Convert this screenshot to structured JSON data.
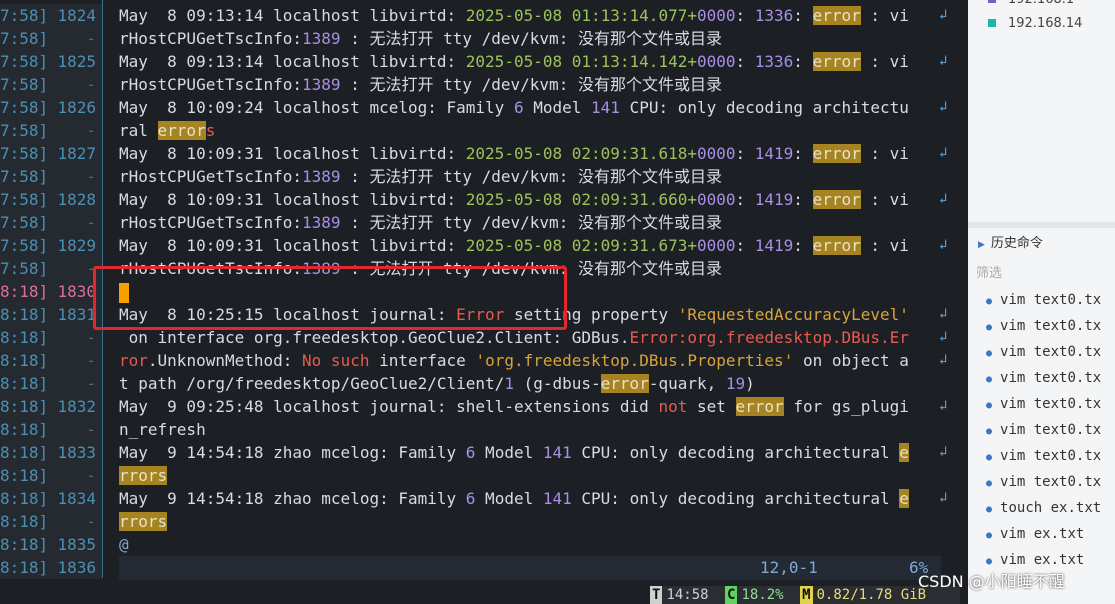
{
  "gutter": {
    "rows": [
      {
        "ts": "7:58]",
        "ln": "1824"
      },
      {
        "ts": "7:58]",
        "ln": "-"
      },
      {
        "ts": "7:58]",
        "ln": "1825"
      },
      {
        "ts": "7:58]",
        "ln": "-"
      },
      {
        "ts": "7:58]",
        "ln": "1826"
      },
      {
        "ts": "7:58]",
        "ln": "-"
      },
      {
        "ts": "7:58]",
        "ln": "1827"
      },
      {
        "ts": "7:58]",
        "ln": "-"
      },
      {
        "ts": "7:58]",
        "ln": "1828"
      },
      {
        "ts": "7:58]",
        "ln": "-"
      },
      {
        "ts": "7:58]",
        "ln": "1829"
      },
      {
        "ts": "7:58]",
        "ln": "-"
      },
      {
        "ts": "8:18]",
        "ln": "1830"
      },
      {
        "ts": "8:18]",
        "ln": "1831"
      },
      {
        "ts": "8:18]",
        "ln": "-"
      },
      {
        "ts": "8:18]",
        "ln": "-"
      },
      {
        "ts": "8:18]",
        "ln": "-"
      },
      {
        "ts": "8:18]",
        "ln": "1832"
      },
      {
        "ts": "8:18]",
        "ln": "-"
      },
      {
        "ts": "8:18]",
        "ln": "1833"
      },
      {
        "ts": "8:18]",
        "ln": "-"
      },
      {
        "ts": "8:18]",
        "ln": "1834"
      },
      {
        "ts": "8:18]",
        "ln": "-"
      },
      {
        "ts": "8:18]",
        "ln": "1835"
      },
      {
        "ts": "8:18]",
        "ln": "1836"
      }
    ]
  },
  "log": {
    "l1824a": [
      "May  8 09:13:14 localhost libvirtd: ",
      "2025-05-08 01:13:14.077+",
      "0000",
      ": ",
      "1336",
      ": ",
      "error",
      " : vi"
    ],
    "l1824b": [
      "rHostCPUGetTscInfo:",
      "1389",
      " : 无法打开 tty /dev/kvm: 没有那个文件或目录"
    ],
    "l1825a": [
      "May  8 09:13:14 localhost libvirtd: ",
      "2025-05-08 01:13:14.142+",
      "0000",
      ": ",
      "1336",
      ": ",
      "error",
      " : vi"
    ],
    "l1825b": [
      "rHostCPUGetTscInfo:",
      "1389",
      " : 无法打开 tty /dev/kvm: 没有那个文件或目录"
    ],
    "l1826a": [
      "May  8 10:09:24 localhost mcelog: Family ",
      "6",
      " Model ",
      "141",
      " CPU: only decoding architectu"
    ],
    "l1826b": [
      "ral ",
      "error",
      "s"
    ],
    "l1827a": [
      "May  8 10:09:31 localhost libvirtd: ",
      "2025-05-08 02:09:31.618+",
      "0000",
      ": ",
      "1419",
      ": ",
      "error",
      " : vi"
    ],
    "l1827b": [
      "rHostCPUGetTscInfo:",
      "1389",
      " : 无法打开 tty /dev/kvm: 没有那个文件或目录"
    ],
    "l1828a": [
      "May  8 10:09:31 localhost libvirtd: ",
      "2025-05-08 02:09:31.660+",
      "0000",
      ": ",
      "1419",
      ": ",
      "error",
      " : vi"
    ],
    "l1828b": [
      "rHostCPUGetTscInfo:",
      "1389",
      " : 无法打开 tty /dev/kvm: 没有那个文件或目录"
    ],
    "l1829a": [
      "May  8 10:09:31 localhost libvirtd: ",
      "2025-05-08 02:09:31.673+",
      "0000",
      ": ",
      "1419",
      ": ",
      "error",
      " : vi"
    ],
    "l1829b": [
      "rHostCPUGetTscInfo:",
      "1389",
      " : 无法打开 tty /dev/kvm: 没有那个文件或目录"
    ],
    "l1831a": [
      "May  8 10:25:15 localhost journal: ",
      "Error",
      " setting property ",
      "'RequestedAccuracyLevel'"
    ],
    "l1831b": [
      " on interface org.freedesktop.GeoClue2.Client: GDBus.",
      "Error",
      ":org.freedesktop.DBus.Er"
    ],
    "l1831c": [
      "ror",
      ".UnknownMethod: ",
      "No such",
      " interface ",
      "'org.freedesktop.DBus.Properties'",
      " on object a"
    ],
    "l1831d": [
      "t path /org/freedesktop/GeoClue2/Client/",
      "1",
      " (g-dbus-",
      "error",
      "-quark, ",
      "19",
      ")"
    ],
    "l1832a": [
      "May  9 09:25:48 localhost journal: shell-extensions did ",
      "not",
      " set ",
      "error",
      " for gs_plugi"
    ],
    "l1832b": [
      "n_refresh"
    ],
    "l1833a": [
      "May  9 14:54:18 zhao mcelog: Family ",
      "6",
      " Model ",
      "141",
      " CPU: only decoding architectural ",
      "e"
    ],
    "l1833b": [
      "rrors"
    ],
    "l1834a": [
      "May  9 14:54:18 zhao mcelog: Family ",
      "6",
      " Model ",
      "141",
      " CPU: only decoding architectural ",
      "e"
    ],
    "l1834b": [
      "rrors"
    ],
    "l1835": "@"
  },
  "status": {
    "position": "12,0-1",
    "percent": "6%"
  },
  "strip": {
    "t_label": "T",
    "time": "14:58",
    "c_label": "C",
    "cpu": "18.2%",
    "m_label": "M",
    "mem": "0.82/1.78 GiB"
  },
  "panel": {
    "ips": [
      {
        "text": "192.168.1",
        "color": "#7a5cd6"
      },
      {
        "text": "192.168.14",
        "color": "#1fb5a8"
      }
    ],
    "history_title": "历史命令",
    "filter_placeholder": "筛选",
    "history": [
      "vim text0.tx",
      "vim text0.tx",
      "vim text0.tx",
      "vim text0.tx",
      "vim text0.tx",
      "vim text0.tx",
      "vim text0.tx",
      "vim text0.tx",
      "touch ex.txt",
      "vim ex.txt",
      "vim ex.txt"
    ]
  },
  "watermark": "CSDN @小阳睡不醒"
}
